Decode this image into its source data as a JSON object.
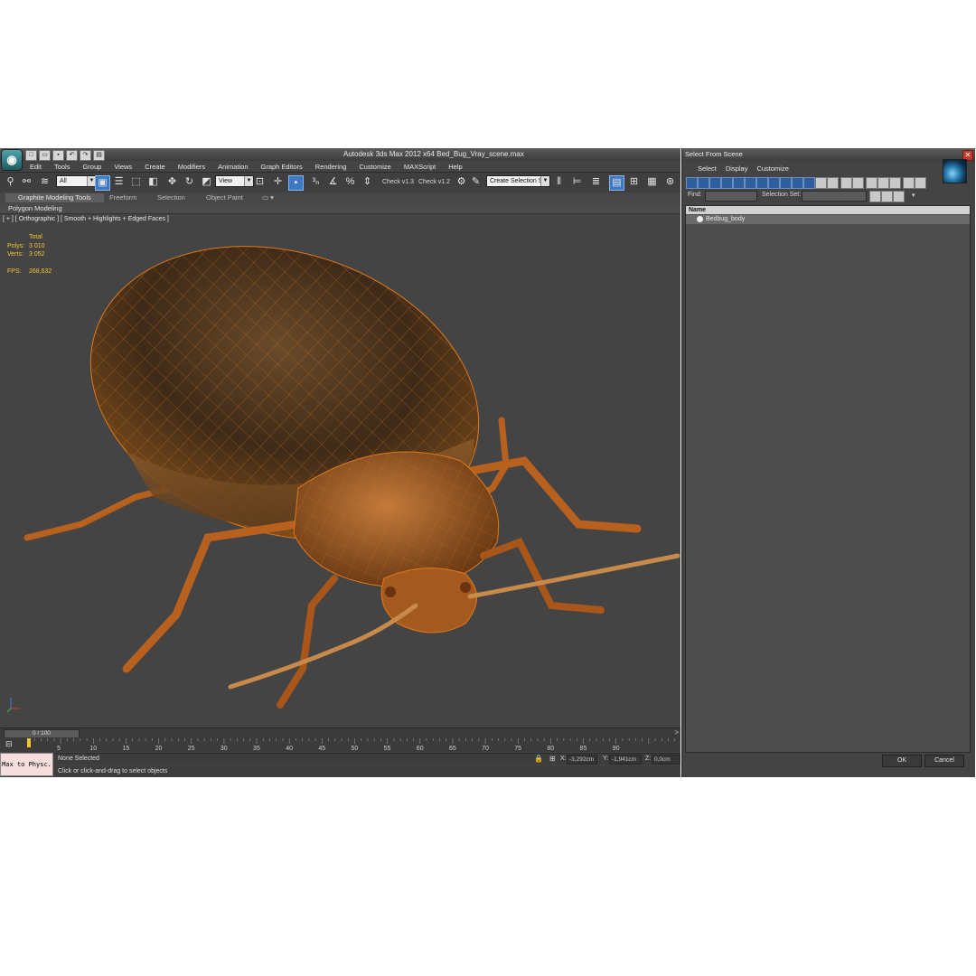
{
  "app": {
    "title": "Autodesk 3ds Max  2012 x64     Bed_Bug_Vray_scene.max",
    "logo": "3ds-max-logo",
    "quick_access": [
      "new-icon",
      "open-icon",
      "save-icon",
      "undo-icon",
      "redo-icon",
      "project-icon"
    ]
  },
  "menu": [
    "Edit",
    "Tools",
    "Group",
    "Views",
    "Create",
    "Modifiers",
    "Animation",
    "Graph Editors",
    "Rendering",
    "Customize",
    "MAXScript",
    "Help"
  ],
  "toolbar": {
    "selection_filter": "All",
    "reference_coord": "View",
    "named_selection": "Create Selection Se",
    "check1_label": "Check v1.3",
    "check2_label": "Check v1.2"
  },
  "ribbon": {
    "tabs": [
      "Graphite Modeling Tools",
      "Freeform",
      "Selection",
      "Object Paint"
    ],
    "sub_label": "Polygon Modeling"
  },
  "viewport": {
    "label": "[ + ] [ Orthographic ] [ Smooth + Highlights + Edged Faces ]",
    "stats": {
      "header": "Total",
      "polys_label": "Polys:",
      "polys": "3 010",
      "verts_label": "Verts:",
      "verts": "3 052",
      "fps_label": "FPS:",
      "fps": "268,632"
    }
  },
  "timeline": {
    "frame_indicator": "0 / 100",
    "current_frame": 0,
    "frame_count": 100,
    "ticks": [
      "5",
      "10",
      "15",
      "20",
      "25",
      "30",
      "35",
      "40",
      "45",
      "50",
      "55",
      "60",
      "65",
      "70",
      "75",
      "80",
      "85",
      "90"
    ]
  },
  "status": {
    "maxscript_label": "Max to Physc.",
    "selection": "None Selected",
    "prompt": "Click or click-and-drag to select objects",
    "x_label": "X:",
    "x": "-3,292cm",
    "y_label": "Y:",
    "y": "-1,941cm",
    "z_label": "Z:",
    "z": "0,0cm"
  },
  "dialog": {
    "title": "Select From Scene",
    "menu": [
      "Select",
      "Display",
      "Customize"
    ],
    "find_label": "Find:",
    "selection_set_label": "Selection Set:",
    "column_name": "Name",
    "items": [
      "Bedbug_body"
    ],
    "ok_label": "OK",
    "cancel_label": "Cancel"
  },
  "colors": {
    "stats_text": "#f3c634",
    "viewport_bg": "#444444",
    "wire": "#e07a1a",
    "accent_blue": "#3c78c4"
  }
}
